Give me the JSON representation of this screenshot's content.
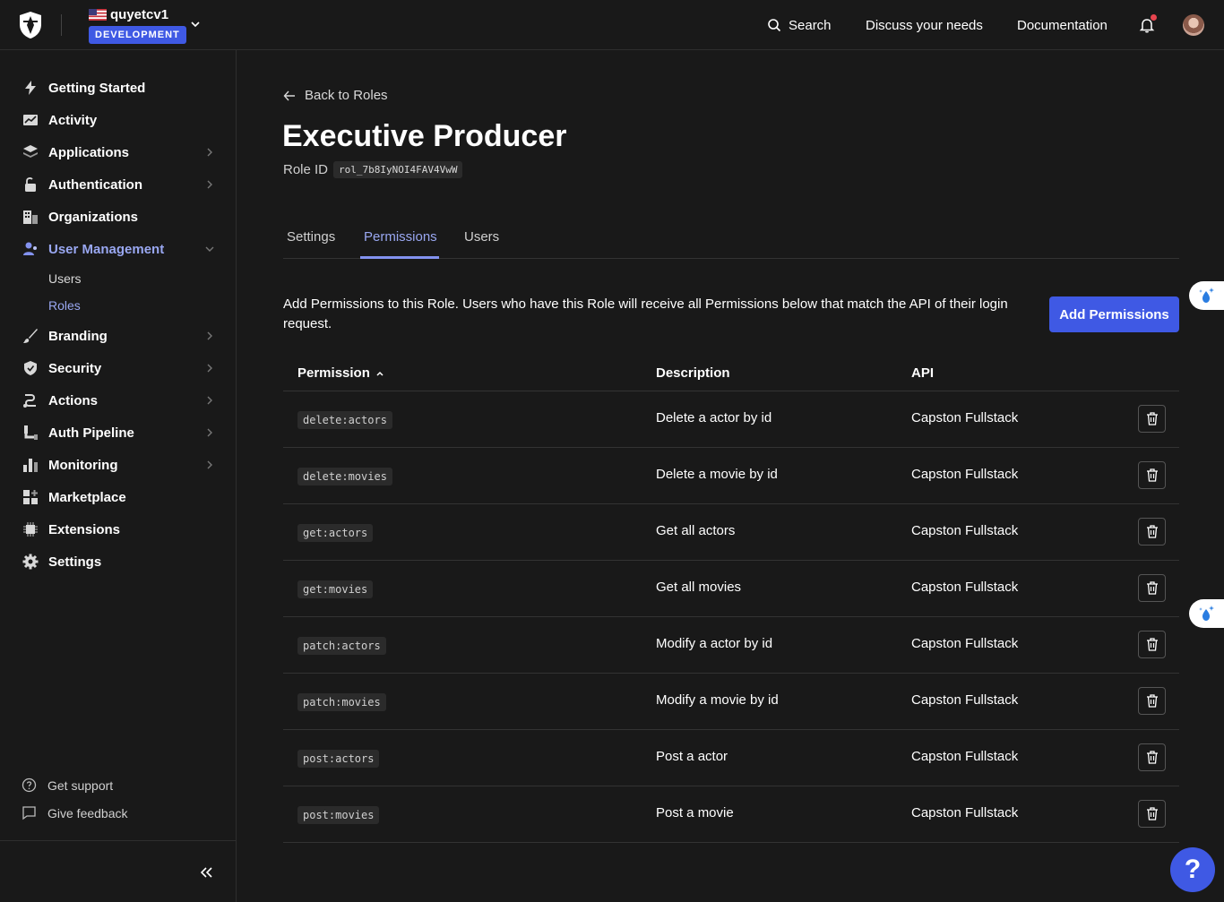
{
  "topbar": {
    "logo_icon": "auth0-shield-icon",
    "tenant_name": "quyetcv1",
    "tenant_flag_icon": "us-flag-icon",
    "environment_badge": "DEVELOPMENT",
    "search_label": "Search",
    "discuss_label": "Discuss your needs",
    "docs_label": "Documentation",
    "notification_icon": "bell-icon",
    "notification_dot_color": "#e8454f",
    "avatar_icon": "user-avatar"
  },
  "sidebar": {
    "items": [
      {
        "label": "Getting Started",
        "icon": "lightning-icon"
      },
      {
        "label": "Activity",
        "icon": "activity-chart-icon"
      },
      {
        "label": "Applications",
        "icon": "layers-icon"
      },
      {
        "label": "Authentication",
        "icon": "lock-icon"
      },
      {
        "label": "Organizations",
        "icon": "building-icon"
      },
      {
        "label": "User Management",
        "icon": "users-icon"
      },
      {
        "label": "Branding",
        "icon": "brush-icon"
      },
      {
        "label": "Security",
        "icon": "shield-check-icon"
      },
      {
        "label": "Actions",
        "icon": "actions-icon"
      },
      {
        "label": "Auth Pipeline",
        "icon": "pipeline-icon"
      },
      {
        "label": "Monitoring",
        "icon": "bar-chart-icon"
      },
      {
        "label": "Marketplace",
        "icon": "grid-plus-icon"
      },
      {
        "label": "Extensions",
        "icon": "chip-icon"
      },
      {
        "label": "Settings",
        "icon": "gear-icon"
      }
    ],
    "sub_items": [
      {
        "label": "Users"
      },
      {
        "label": "Roles"
      }
    ],
    "footer": {
      "support_label": "Get support",
      "feedback_label": "Give feedback"
    }
  },
  "main": {
    "back_label": "Back to Roles",
    "title": "Executive Producer",
    "role_id_label": "Role ID",
    "role_id_value": "rol_7b8IyNOI4FAV4VwW",
    "tabs": [
      {
        "label": "Settings"
      },
      {
        "label": "Permissions"
      },
      {
        "label": "Users"
      }
    ],
    "description": "Add Permissions to this Role. Users who have this Role will receive all Permissions below that match the API of their login request.",
    "add_button_label": "Add Permissions",
    "table": {
      "columns": [
        "Permission",
        "Description",
        "API"
      ],
      "rows": [
        {
          "permission": "delete:actors",
          "description": "Delete a actor by id",
          "api": "Capston Fullstack"
        },
        {
          "permission": "delete:movies",
          "description": "Delete a movie by id",
          "api": "Capston Fullstack"
        },
        {
          "permission": "get:actors",
          "description": "Get all actors",
          "api": "Capston Fullstack"
        },
        {
          "permission": "get:movies",
          "description": "Get all movies",
          "api": "Capston Fullstack"
        },
        {
          "permission": "patch:actors",
          "description": "Modify a actor by id",
          "api": "Capston Fullstack"
        },
        {
          "permission": "patch:movies",
          "description": "Modify a movie by id",
          "api": "Capston Fullstack"
        },
        {
          "permission": "post:actors",
          "description": "Post a actor",
          "api": "Capston Fullstack"
        },
        {
          "permission": "post:movies",
          "description": "Post a movie",
          "api": "Capston Fullstack"
        }
      ]
    }
  },
  "help_button_label": "?",
  "colors": {
    "accent": "#3f59e4",
    "active_text": "#99a7f1",
    "background": "#191919"
  }
}
